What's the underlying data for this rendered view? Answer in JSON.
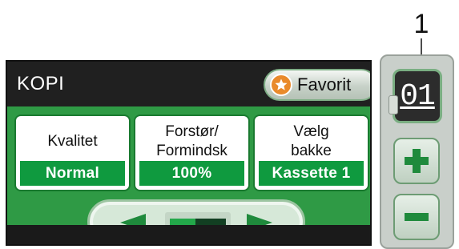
{
  "callout": {
    "number": "1"
  },
  "screen": {
    "title": "KOPI",
    "favorite_label": "Favorit",
    "options": [
      {
        "label": "Kvalitet",
        "value": "Normal"
      },
      {
        "label": "Forstør/\nFormindsk",
        "value": "100%"
      },
      {
        "label": "Vælg\nbakke",
        "value": "Kassette 1"
      }
    ],
    "scroll_position": 0.45
  },
  "side_panel": {
    "copies": "01",
    "plus_icon": "plus-icon",
    "minus_icon": "minus-icon"
  },
  "colors": {
    "screen_bg": "#202020",
    "accent_green": "#2f9a45",
    "value_green": "#0f9a3f",
    "star_orange": "#e98a2b"
  }
}
